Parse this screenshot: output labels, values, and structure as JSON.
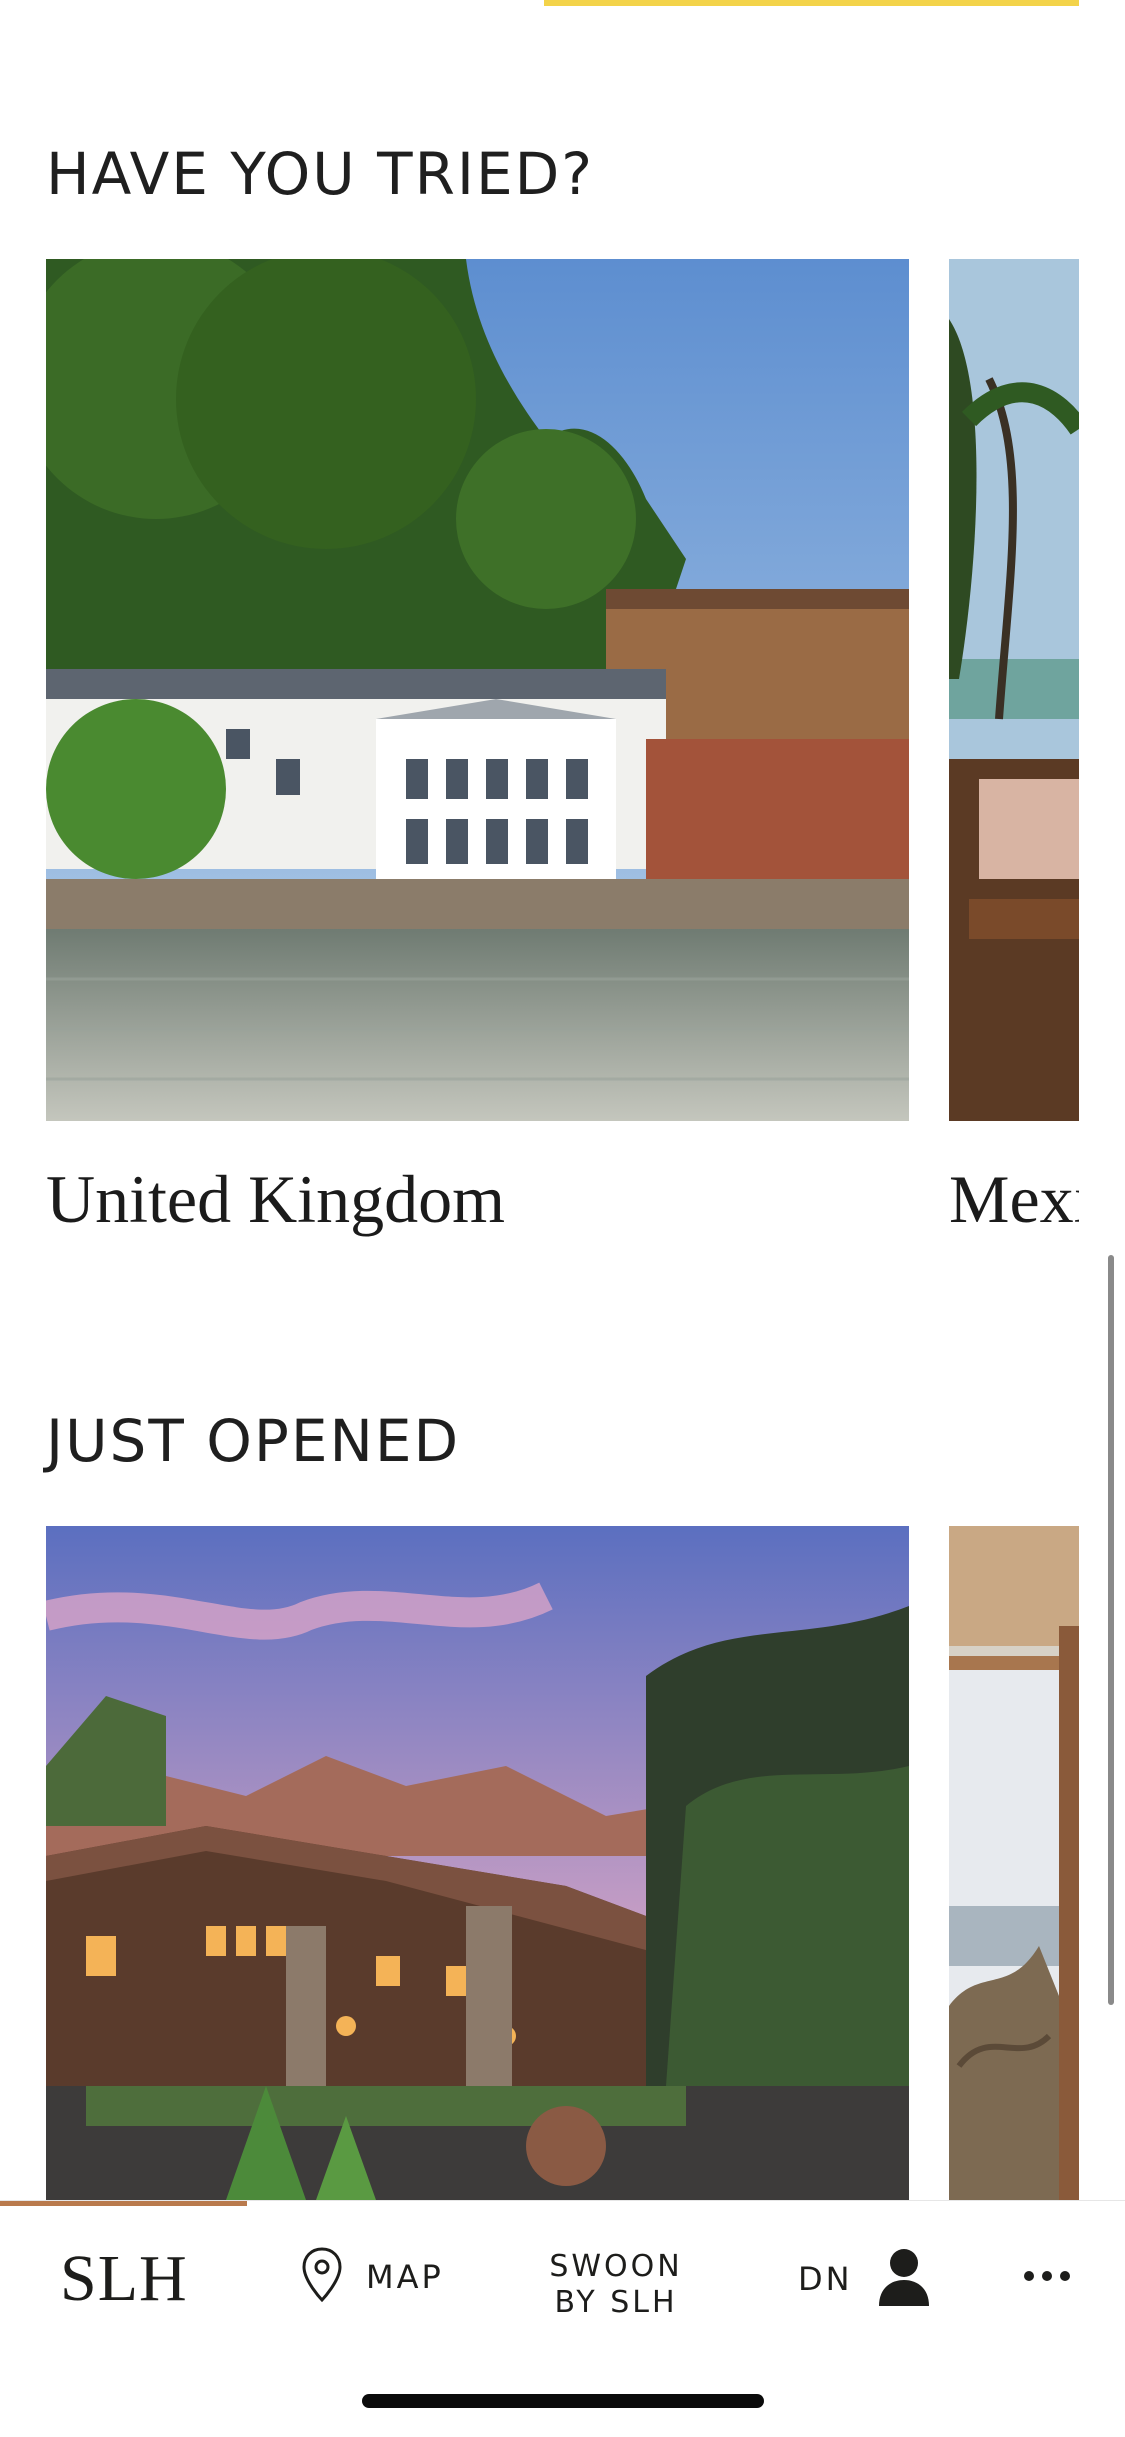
{
  "sections": {
    "have_you_tried": {
      "title": "HAVE YOU TRIED?",
      "cards": [
        {
          "label": "United Kingdom"
        },
        {
          "label": "Mexi"
        }
      ]
    },
    "just_opened": {
      "title": "JUST OPENED"
    }
  },
  "tabbar": {
    "logo": "SLH",
    "map_label": "MAP",
    "swoon_line1": "SWOON",
    "swoon_line2": "BY SLH",
    "account_initials": "DN"
  },
  "colors": {
    "accent_yellow": "#f3d34a",
    "progress_bronze": "#b97a4d",
    "text": "#1d1d1b"
  },
  "icons": [
    "map-pin-icon",
    "user-icon",
    "more-dots-icon"
  ]
}
